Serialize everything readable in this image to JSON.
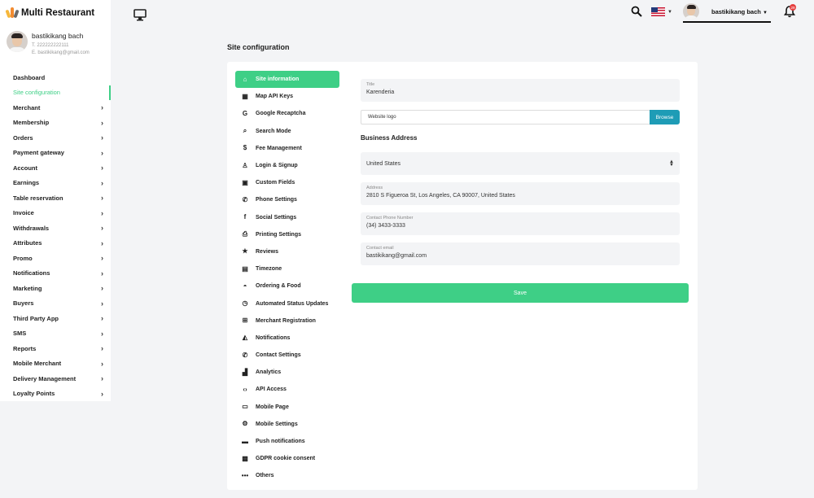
{
  "app": {
    "title": "Multi Restaurant"
  },
  "profile": {
    "name": "bastikikang bach",
    "phone": "T. 222222222111",
    "email": "E. bastikikang@gmail.com"
  },
  "sidebar": {
    "items": [
      {
        "label": "Dashboard",
        "chevron": false,
        "active": false
      },
      {
        "label": "Site configuration",
        "chevron": false,
        "active": true
      },
      {
        "label": "Merchant",
        "chevron": true,
        "active": false
      },
      {
        "label": "Membership",
        "chevron": true,
        "active": false
      },
      {
        "label": "Orders",
        "chevron": true,
        "active": false
      },
      {
        "label": "Payment gateway",
        "chevron": true,
        "active": false
      },
      {
        "label": "Account",
        "chevron": true,
        "active": false
      },
      {
        "label": "Earnings",
        "chevron": true,
        "active": false
      },
      {
        "label": "Table reservation",
        "chevron": true,
        "active": false
      },
      {
        "label": "Invoice",
        "chevron": true,
        "active": false
      },
      {
        "label": "Withdrawals",
        "chevron": true,
        "active": false
      },
      {
        "label": "Attributes",
        "chevron": true,
        "active": false
      },
      {
        "label": "Promo",
        "chevron": true,
        "active": false
      },
      {
        "label": "Notifications",
        "chevron": true,
        "active": false
      },
      {
        "label": "Marketing",
        "chevron": true,
        "active": false
      },
      {
        "label": "Buyers",
        "chevron": true,
        "active": false
      },
      {
        "label": "Third Party App",
        "chevron": true,
        "active": false
      },
      {
        "label": "SMS",
        "chevron": true,
        "active": false
      },
      {
        "label": "Reports",
        "chevron": true,
        "active": false
      },
      {
        "label": "Mobile Merchant",
        "chevron": true,
        "active": false
      },
      {
        "label": "Delivery Management",
        "chevron": true,
        "active": false
      },
      {
        "label": "Loyalty Points",
        "chevron": true,
        "active": false
      }
    ]
  },
  "header": {
    "username": "bastikikang bach",
    "notification_count": "29",
    "language_flag": "us-flag"
  },
  "page": {
    "title": "Site configuration"
  },
  "settings_nav": {
    "items": [
      {
        "label": "Site information",
        "icon": "⌂",
        "icon_name": "home-icon",
        "active": true
      },
      {
        "label": "Map API Keys",
        "icon": "▦",
        "icon_name": "map-icon",
        "active": false
      },
      {
        "label": "Google Recaptcha",
        "icon": "G",
        "icon_name": "google-icon",
        "active": false
      },
      {
        "label": "Search Mode",
        "icon": "⌕",
        "icon_name": "search-icon",
        "active": false
      },
      {
        "label": "Fee Management",
        "icon": "$",
        "icon_name": "fee-icon",
        "active": false
      },
      {
        "label": "Login & Signup",
        "icon": "♙",
        "icon_name": "user-icon",
        "active": false
      },
      {
        "label": "Custom Fields",
        "icon": "▣",
        "icon_name": "custom-fields-icon",
        "active": false
      },
      {
        "label": "Phone Settings",
        "icon": "✆",
        "icon_name": "phone-icon",
        "active": false
      },
      {
        "label": "Social Settings",
        "icon": "f",
        "icon_name": "facebook-icon",
        "active": false
      },
      {
        "label": "Printing Settings",
        "icon": "⎙",
        "icon_name": "printer-icon",
        "active": false
      },
      {
        "label": "Reviews",
        "icon": "★",
        "icon_name": "star-icon",
        "active": false
      },
      {
        "label": "Timezone",
        "icon": "▤",
        "icon_name": "calendar-icon",
        "active": false
      },
      {
        "label": "Ordering & Food",
        "icon": "◓",
        "icon_name": "basket-icon",
        "active": false
      },
      {
        "label": "Automated Status Updates",
        "icon": "◷",
        "icon_name": "clock-icon",
        "active": false
      },
      {
        "label": "Merchant Registration",
        "icon": "⊞",
        "icon_name": "registration-icon",
        "active": false
      },
      {
        "label": "Notifications",
        "icon": "◭",
        "icon_name": "bell-icon",
        "active": false
      },
      {
        "label": "Contact Settings",
        "icon": "✆",
        "icon_name": "contact-phone-icon",
        "active": false
      },
      {
        "label": "Analytics",
        "icon": "▟",
        "icon_name": "analytics-icon",
        "active": false
      },
      {
        "label": "API Access",
        "icon": "‹›",
        "icon_name": "code-icon",
        "active": false
      },
      {
        "label": "Mobile Page",
        "icon": "▭",
        "icon_name": "mobile-page-icon",
        "active": false
      },
      {
        "label": "Mobile Settings",
        "icon": "⚙",
        "icon_name": "gear-icon",
        "active": false
      },
      {
        "label": "Push notifications",
        "icon": "▬",
        "icon_name": "message-icon",
        "active": false
      },
      {
        "label": "GDPR cookie consent",
        "icon": "▩",
        "icon_name": "cookie-icon",
        "active": false
      },
      {
        "label": "Others",
        "icon": "•••",
        "icon_name": "more-icon",
        "active": false
      }
    ]
  },
  "form": {
    "title_label": "Title",
    "title_value": "Karenderia",
    "website_logo_label": "Website logo",
    "browse_label": "Browse",
    "business_address_title": "Business Address",
    "country_value": "United States",
    "address_label": "Address",
    "address_value": "2810 S Figueroa St, Los Angeles, CA 90007, United States",
    "phone_label": "Contact Phone Number",
    "phone_value": "(34) 3433-3333",
    "email_label": "Contact email",
    "email_value": "bastikikang@gmail.com",
    "save_label": "Save"
  },
  "colors": {
    "accent": "#3ecf86",
    "browse": "#1e9cb6",
    "badge": "#e53e3e",
    "background": "#f3f4f6"
  }
}
